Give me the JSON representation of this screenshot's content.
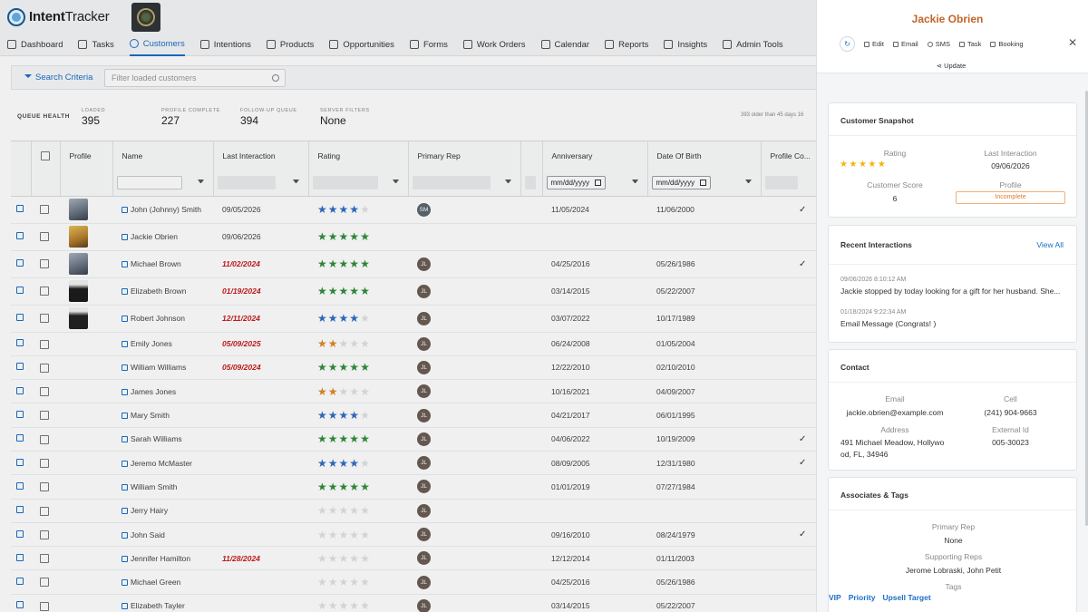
{
  "app": {
    "logo_text_bold": "Intent",
    "logo_text": "Tracker"
  },
  "nav": [
    {
      "label": "Dashboard",
      "icon": "dashboard-icon",
      "active": false
    },
    {
      "label": "Tasks",
      "icon": "tasks-icon",
      "active": false
    },
    {
      "label": "Customers",
      "icon": "customers-icon",
      "active": true
    },
    {
      "label": "Intentions",
      "icon": "intentions-icon",
      "active": false
    },
    {
      "label": "Products",
      "icon": "products-icon",
      "active": false
    },
    {
      "label": "Opportunities",
      "icon": "opportunities-icon",
      "active": false
    },
    {
      "label": "Forms",
      "icon": "forms-icon",
      "active": false
    },
    {
      "label": "Work Orders",
      "icon": "work-orders-icon",
      "active": false
    },
    {
      "label": "Calendar",
      "icon": "calendar-icon",
      "active": false
    },
    {
      "label": "Reports",
      "icon": "reports-icon",
      "active": false
    },
    {
      "label": "Insights",
      "icon": "insights-icon",
      "active": false
    },
    {
      "label": "Admin Tools",
      "icon": "admin-tools-icon",
      "active": false
    }
  ],
  "search": {
    "criteria_label": "Search Criteria",
    "placeholder": "Filter loaded customers"
  },
  "queue": {
    "title": "QUEUE HEALTH",
    "metrics": [
      {
        "label": "LOADED",
        "value": "395"
      },
      {
        "label": "PROFILE COMPLETE",
        "value": "227"
      },
      {
        "label": "FOLLOW-UP QUEUE",
        "value": "394"
      },
      {
        "label": "SERVER FILTERS",
        "value": "None"
      }
    ],
    "note": "393 older than 45 days  16"
  },
  "table": {
    "columns": [
      "Profile",
      "Name",
      "Last Interaction",
      "Rating",
      "Primary Rep",
      "",
      "Anniversary",
      "Date Of Birth",
      "Profile Co..."
    ],
    "date_placeholder": "mm/dd/yyyy",
    "rows": [
      {
        "avatar": "photo-a",
        "name": "John (Johnny) Smith",
        "last": "09/05/2026",
        "overdue": false,
        "rating": 4,
        "color": "blue",
        "rep": "SM",
        "anniv": "11/05/2024",
        "dob": "11/06/2000",
        "complete": true
      },
      {
        "avatar": "photo-b",
        "name": "Jackie Obrien",
        "last": "09/06/2026",
        "overdue": false,
        "rating": 5,
        "color": "green",
        "rep": "",
        "anniv": "",
        "dob": "",
        "complete": false
      },
      {
        "avatar": "photo-a",
        "name": "Michael Brown",
        "last": "11/02/2024",
        "overdue": true,
        "rating": 5,
        "color": "green",
        "rep": "JL",
        "anniv": "04/25/2016",
        "dob": "05/26/1986",
        "complete": true
      },
      {
        "avatar": "photo-c",
        "name": "Elizabeth Brown",
        "last": "01/19/2024",
        "overdue": true,
        "rating": 5,
        "color": "green",
        "rep": "JL",
        "anniv": "03/14/2015",
        "dob": "05/22/2007",
        "complete": false
      },
      {
        "avatar": "photo-d",
        "name": "Robert Johnson",
        "last": "12/11/2024",
        "overdue": true,
        "rating": 4,
        "color": "blue",
        "rep": "JL",
        "anniv": "03/07/2022",
        "dob": "10/17/1989",
        "complete": false
      },
      {
        "avatar": "",
        "name": "Emily Jones",
        "last": "05/09/2025",
        "overdue": true,
        "rating": 2,
        "color": "orange",
        "rep": "JL",
        "anniv": "06/24/2008",
        "dob": "01/05/2004",
        "complete": false
      },
      {
        "avatar": "",
        "name": "William Williams",
        "last": "05/09/2024",
        "overdue": true,
        "rating": 5,
        "color": "green",
        "rep": "JL",
        "anniv": "12/22/2010",
        "dob": "02/10/2010",
        "complete": false
      },
      {
        "avatar": "",
        "name": "James Jones",
        "last": "",
        "overdue": false,
        "rating": 2,
        "color": "orange",
        "rep": "JL",
        "anniv": "10/16/2021",
        "dob": "04/09/2007",
        "complete": false
      },
      {
        "avatar": "",
        "name": "Mary Smith",
        "last": "",
        "overdue": false,
        "rating": 4,
        "color": "blue",
        "rep": "JL",
        "anniv": "04/21/2017",
        "dob": "06/01/1995",
        "complete": false
      },
      {
        "avatar": "",
        "name": "Sarah Williams",
        "last": "",
        "overdue": false,
        "rating": 5,
        "color": "green",
        "rep": "JL",
        "anniv": "04/06/2022",
        "dob": "10/19/2009",
        "complete": true
      },
      {
        "avatar": "",
        "name": "Jeremo McMaster",
        "last": "",
        "overdue": false,
        "rating": 4,
        "color": "blue",
        "rep": "JL",
        "anniv": "08/09/2005",
        "dob": "12/31/1980",
        "complete": true
      },
      {
        "avatar": "",
        "name": "William Smith",
        "last": "",
        "overdue": false,
        "rating": 5,
        "color": "green",
        "rep": "JL",
        "anniv": "01/01/2019",
        "dob": "07/27/1984",
        "complete": false
      },
      {
        "avatar": "",
        "name": "Jerry Hairy",
        "last": "",
        "overdue": false,
        "rating": 0,
        "color": "none",
        "rep": "JL",
        "anniv": "",
        "dob": "",
        "complete": false
      },
      {
        "avatar": "",
        "name": "John Said",
        "last": "",
        "overdue": false,
        "rating": 0,
        "color": "none",
        "rep": "JL",
        "anniv": "09/16/2010",
        "dob": "08/24/1979",
        "complete": true
      },
      {
        "avatar": "",
        "name": "Jennifer Hamilton",
        "last": "11/28/2024",
        "overdue": true,
        "rating": 0,
        "color": "none",
        "rep": "JL",
        "anniv": "12/12/2014",
        "dob": "01/11/2003",
        "complete": false
      },
      {
        "avatar": "",
        "name": "Michael Green",
        "last": "",
        "overdue": false,
        "rating": 0,
        "color": "none",
        "rep": "JL",
        "anniv": "04/25/2016",
        "dob": "05/26/1986",
        "complete": false
      },
      {
        "avatar": "",
        "name": "Elizabeth Tayler",
        "last": "",
        "overdue": false,
        "rating": 0,
        "color": "none",
        "rep": "JL",
        "anniv": "03/14/2015",
        "dob": "05/22/2007",
        "complete": false
      }
    ]
  },
  "panel": {
    "name": "Jackie Obrien",
    "actions": [
      "Edit",
      "Email",
      "SMS",
      "Task",
      "Booking"
    ],
    "update_label": "Update",
    "snapshot": {
      "title": "Customer Snapshot",
      "rating_label": "Rating",
      "rating": 5,
      "last_label": "Last Interaction",
      "last_value": "09/06/2026",
      "score_label": "Customer Score",
      "score_value": "6",
      "profile_label": "Profile",
      "profile_value": "Incomplete"
    },
    "interactions": {
      "title": "Recent Interactions",
      "view_all": "View All",
      "items": [
        {
          "time": "09/06/2026 8:10:12 AM",
          "text": "Jackie stopped by today looking for a gift for her husband. She..."
        },
        {
          "time": "01/18/2024 9:22:34 AM",
          "text": "Email Message (Congrats! )"
        }
      ]
    },
    "contact": {
      "title": "Contact",
      "email_label": "Email",
      "email": "jackie.obrien@example.com",
      "cell_label": "Cell",
      "cell": "(241) 904-9663",
      "address_label": "Address",
      "address_line1": "491 Michael Meadow, Hollywo",
      "address_line2": "od, FL, 34946",
      "external_label": "External Id",
      "external": "005-30023"
    },
    "associates": {
      "title": "Associates & Tags",
      "primary_label": "Primary Rep",
      "primary": "None",
      "supporting_label": "Supporting Reps",
      "supporting": "Jerome Lobraski, John Petit",
      "tags_label": "Tags",
      "tags": [
        "VIP",
        "Priority",
        "Upsell Target"
      ]
    }
  }
}
